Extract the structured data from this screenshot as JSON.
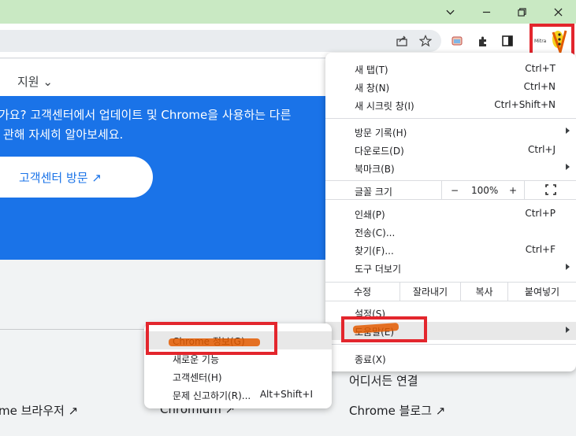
{
  "window": {
    "controls": [
      "minimize",
      "restore",
      "close"
    ],
    "titlebar_color": "#c9e9c3"
  },
  "toolbar": {
    "icons": [
      "share-icon",
      "bookmark-star-icon",
      "media-icon",
      "extensions-icon",
      "side-panel-icon",
      "profile-icon",
      "more-menu-icon"
    ]
  },
  "page": {
    "nav_support": "지원 ⌄",
    "hero_line1": "가요? 고객센터에서 업데이트 및 Chrome을 사용하는 다른",
    "hero_line2": "관해 자세히 알아보세요.",
    "hero_button": "고객센터 방문 ↗",
    "footer_link1": "me 브라우저 ↗",
    "footer_link2": "Chromium ↗",
    "footer_head3": "어디서든 연결",
    "footer_link3": "Chrome 블로그 ↗",
    "accent": "#1a73e8"
  },
  "menu": {
    "new_tab": {
      "label": "새 탭(T)",
      "shortcut": "Ctrl+T"
    },
    "new_window": {
      "label": "새 창(N)",
      "shortcut": "Ctrl+N"
    },
    "new_incognito": {
      "label": "새 시크릿 창(I)",
      "shortcut": "Ctrl+Shift+N"
    },
    "history": {
      "label": "방문 기록(H)"
    },
    "downloads": {
      "label": "다운로드(D)",
      "shortcut": "Ctrl+J"
    },
    "bookmarks": {
      "label": "북마크(B)"
    },
    "zoom": {
      "label": "글꼴 크기",
      "minus": "−",
      "value": "100%",
      "plus": "+"
    },
    "print": {
      "label": "인쇄(P)",
      "shortcut": "Ctrl+P"
    },
    "cast": {
      "label": "전송(C)..."
    },
    "find": {
      "label": "찾기(F)...",
      "shortcut": "Ctrl+F"
    },
    "more_tools": {
      "label": "도구 더보기"
    },
    "edit": {
      "label": "수정",
      "cut": "잘라내기",
      "copy": "복사",
      "paste": "붙여넣기"
    },
    "settings": {
      "label": "설정(S)"
    },
    "help": {
      "label": "도움말(E)"
    },
    "exit": {
      "label": "종료(X)"
    }
  },
  "help_submenu": {
    "about": {
      "label": "Chrome 정보(G)"
    },
    "whats_new": {
      "label": "새로운 기능"
    },
    "help_center": {
      "label": "고객센터(H)"
    },
    "report": {
      "label": "문제 신고하기(R)...",
      "shortcut": "Alt+Shift+I"
    }
  },
  "annotation_colors": {
    "red_box": "#e3262d",
    "marker": "#e35a00"
  }
}
